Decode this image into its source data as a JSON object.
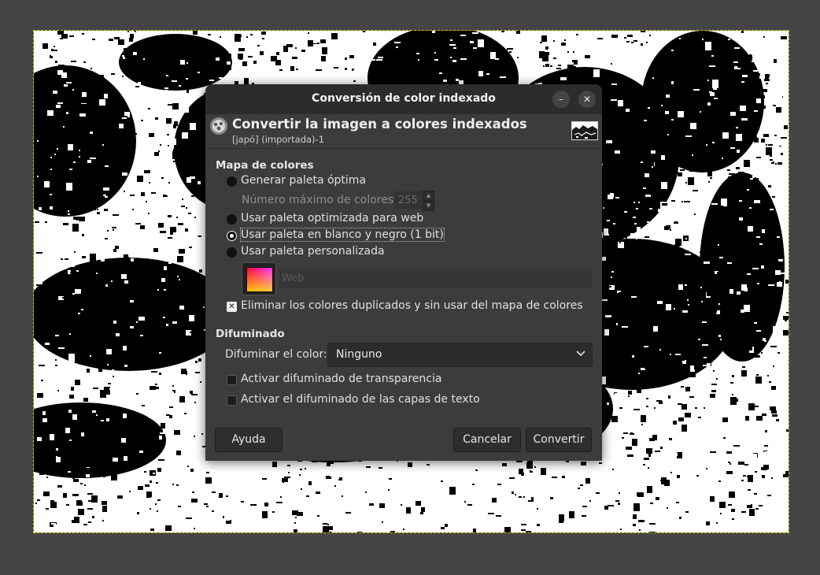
{
  "dialog": {
    "title": "Conversión de color indexado",
    "window_buttons": {
      "minimize": "–",
      "close": "✕"
    },
    "header": {
      "title": "Convertir la imagen a colores indexados",
      "subtitle": "[japó] (importada)-1"
    },
    "colormap": {
      "section_label": "Mapa de colores",
      "options": [
        {
          "label": "Generar paleta óptima",
          "checked": false
        },
        {
          "label": "Usar paleta optimizada para web",
          "checked": false
        },
        {
          "label": "Usar paleta en blanco y negro (1 bit)",
          "checked": true
        },
        {
          "label": "Usar paleta personalizada",
          "checked": false
        }
      ],
      "max_colors_label": "Número máximo de colores:",
      "max_colors_value": "255",
      "palette_name": "Web",
      "remove_unused_label": "Eliminar los colores duplicados y sin usar del mapa de colores",
      "remove_unused_checked": true
    },
    "dithering": {
      "section_label": "Difuminado",
      "dither_label": "Difuminar el color:",
      "dither_value": "Ninguno",
      "transparency_label": "Activar difuminado de transparencia",
      "transparency_checked": false,
      "text_layers_label": "Activar el difuminado de las capas de texto",
      "text_layers_checked": false
    },
    "buttons": {
      "help": "Ayuda",
      "cancel": "Cancelar",
      "convert": "Convertir"
    }
  },
  "icons": [
    "gimp-logo-icon",
    "image-thumbnail",
    "palette-icon",
    "chevron-down-icon",
    "spin-up-icon",
    "spin-down-icon"
  ],
  "colors": {
    "background": "#454545",
    "dialog_bg": "#3c3c3c",
    "titlebar_bg": "#2c2c2c",
    "selection_outline": "#c9c400"
  }
}
